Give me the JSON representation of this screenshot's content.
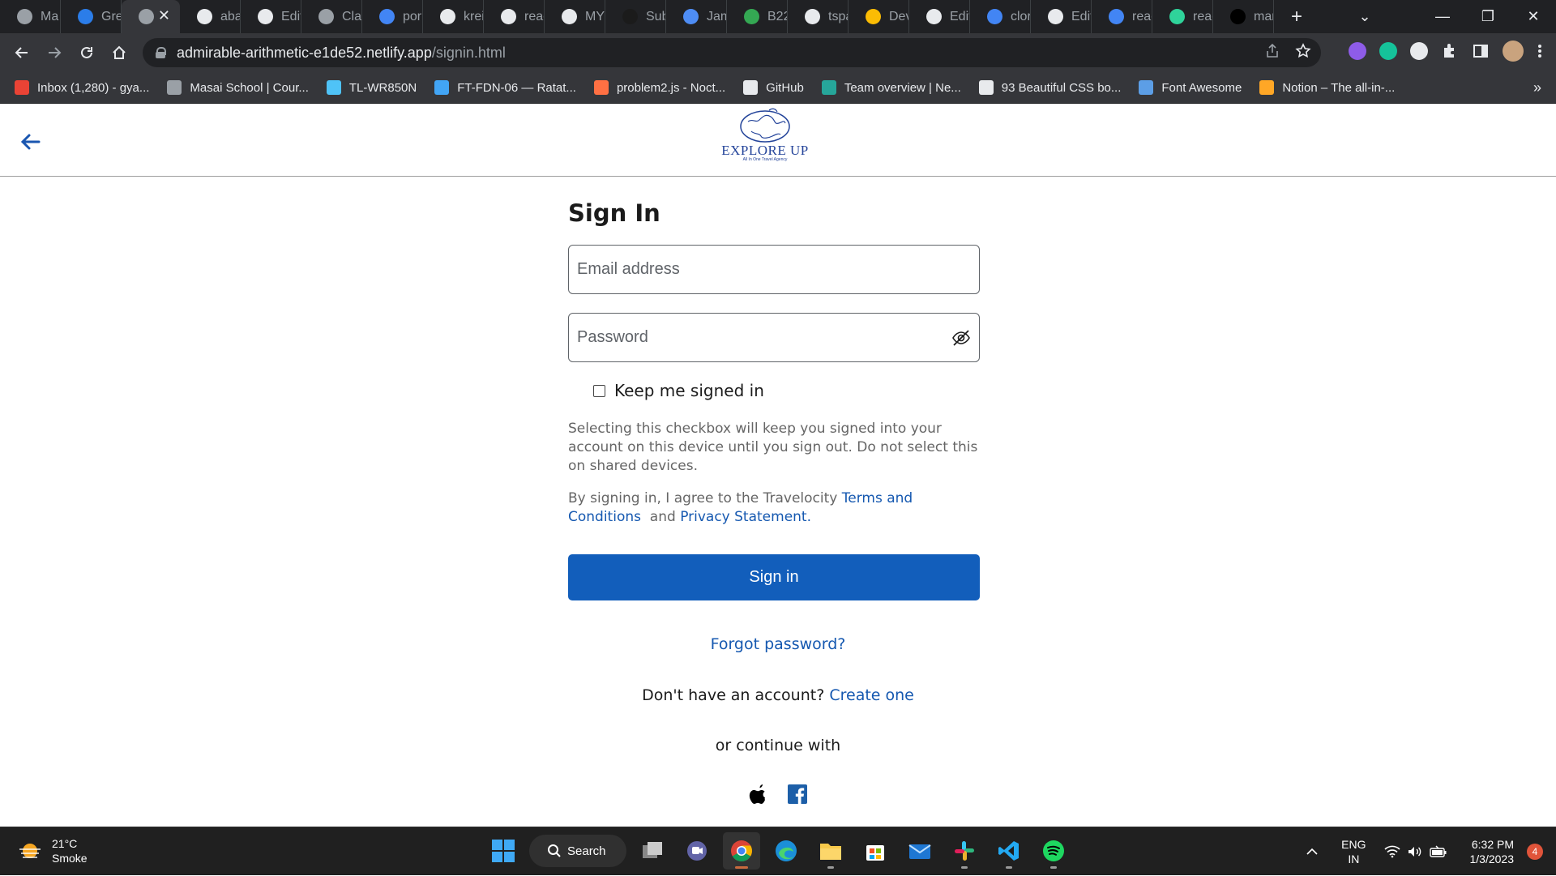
{
  "browser": {
    "tabs": [
      {
        "title": "Ma",
        "color": "#9aa0a6"
      },
      {
        "title": "Gre",
        "color": "#2b7de9"
      },
      {
        "title": "",
        "color": "#9aa0a6",
        "active": true
      },
      {
        "title": "aba",
        "color": "#e8eaed"
      },
      {
        "title": "Edit",
        "color": "#e8eaed"
      },
      {
        "title": "Clar",
        "color": "#9aa0a6"
      },
      {
        "title": "por",
        "color": "#4285f4"
      },
      {
        "title": "krei",
        "color": "#e8eaed"
      },
      {
        "title": "reac",
        "color": "#e8eaed"
      },
      {
        "title": "MYI",
        "color": "#e8eaed"
      },
      {
        "title": "Sub",
        "color": "#1b1b1b"
      },
      {
        "title": "Jam",
        "color": "#4e8df5"
      },
      {
        "title": "B22",
        "color": "#34a853"
      },
      {
        "title": "tspa",
        "color": "#e8eaed"
      },
      {
        "title": "Dev",
        "color": "#fbbc04"
      },
      {
        "title": "Edit",
        "color": "#e8eaed"
      },
      {
        "title": "clor",
        "color": "#4285f4"
      },
      {
        "title": "Edit",
        "color": "#e8eaed"
      },
      {
        "title": "reac",
        "color": "#4285f4"
      },
      {
        "title": "reac",
        "color": "#2fd39a"
      },
      {
        "title": "mar",
        "color": "#000000"
      }
    ],
    "active_tab_close": "✕",
    "new_tab": "+",
    "window_controls": {
      "tabsearch": "⌄",
      "minimize": "—",
      "restore": "❐",
      "close": "✕"
    },
    "url_host": "admirable-arithmetic-e1de52.netlify.app",
    "url_path": "/signin.html",
    "bookmarks": [
      {
        "label": "Inbox (1,280) - gya...",
        "color": "#ea4335"
      },
      {
        "label": "Masai School | Cour...",
        "color": "#9aa0a6"
      },
      {
        "label": "TL-WR850N",
        "color": "#4fc3f7"
      },
      {
        "label": "FT-FDN-06 — Ratat...",
        "color": "#42a5f5"
      },
      {
        "label": "problem2.js - Noct...",
        "color": "#ff7043"
      },
      {
        "label": "GitHub",
        "color": "#e8eaed"
      },
      {
        "label": "Team overview | Ne...",
        "color": "#26a69a"
      },
      {
        "label": "93 Beautiful CSS bo...",
        "color": "#e8eaed"
      },
      {
        "label": "Font Awesome",
        "color": "#5c9ee6"
      },
      {
        "label": "Notion – The all-in-...",
        "color": "#ffa726"
      }
    ],
    "bookmarks_more": "»"
  },
  "header": {
    "logo_text": "EXPLORE UP",
    "logo_tagline": "All In One Travel Agency"
  },
  "form": {
    "title": "Sign In",
    "email_placeholder": "Email address",
    "password_placeholder": "Password",
    "keep_signed_in": "Keep me signed in",
    "help_text": "Selecting this checkbox will keep you signed into your account on this device until you sign out. Do not select this on shared devices.",
    "terms_prefix": "By signing in, I agree to the Travelocity ",
    "terms_link": "Terms and Conditions",
    "terms_and": "and",
    "privacy_link": "Privacy Statement.",
    "signin_button": "Sign in",
    "forgot_password": "Forgot password?",
    "no_account": "Don't have an account?",
    "create_one": "Create one",
    "continue_with": "or continue with"
  },
  "taskbar": {
    "weather_temp": "21°C",
    "weather_desc": "Smoke",
    "search_label": "Search",
    "lang_line1": "ENG",
    "lang_line2": "IN",
    "time": "6:32 PM",
    "date": "1/3/2023",
    "notifications": "4"
  }
}
